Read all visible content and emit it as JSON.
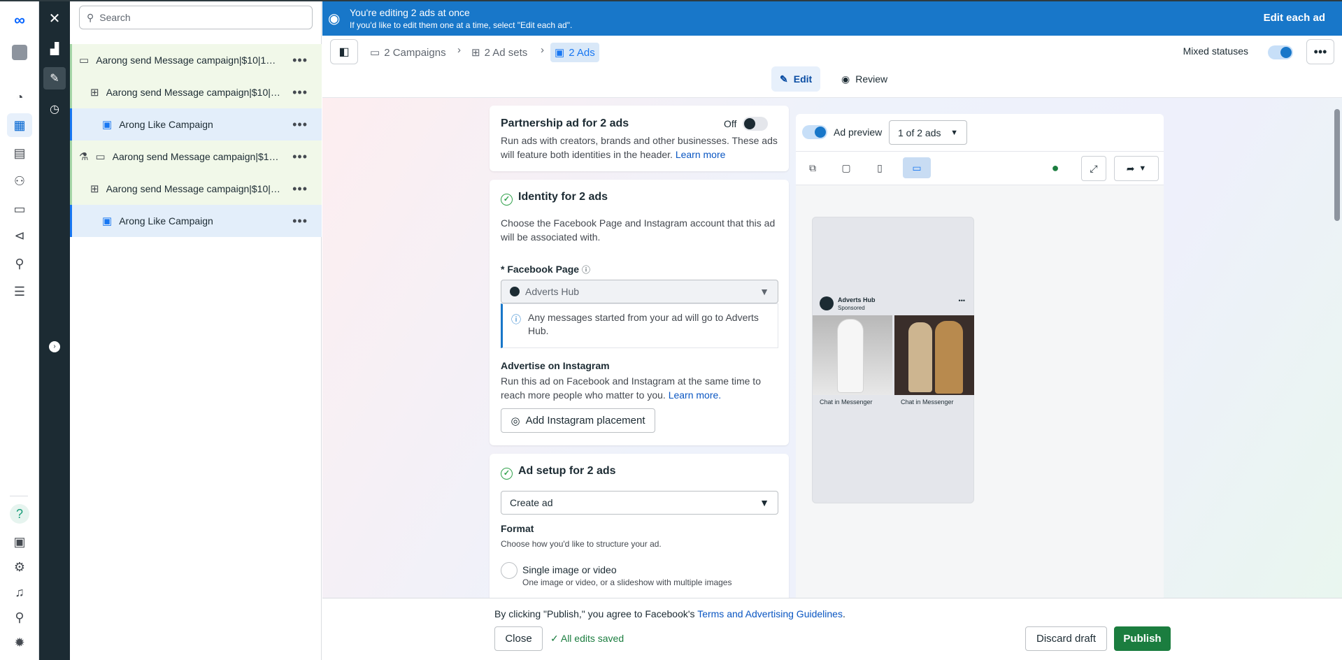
{
  "tree": {
    "search_placeholder": "Search",
    "rows": [
      {
        "type": "campaign",
        "label": "Aarong send Message campaign|$10|10 ..."
      },
      {
        "type": "adset",
        "label": "Aarong send Message campaign|$10|1..."
      },
      {
        "type": "ad",
        "label": "Arong Like Campaign"
      },
      {
        "type": "campaign",
        "label": "Aarong send Message campaign|$10|..."
      },
      {
        "type": "adset",
        "label": "Aarong send Message campaign|$10|1..."
      },
      {
        "type": "ad",
        "label": "Arong Like Campaign"
      }
    ]
  },
  "banner": {
    "title": "You're editing 2 ads at once",
    "subtitle": "If you'd like to edit them one at a time, select \"Edit each ad\".",
    "edit_each": "Edit each ad"
  },
  "header": {
    "breadcrumbs": [
      "2 Campaigns",
      "2 Ad sets",
      "2 Ads"
    ],
    "mixed_statuses": "Mixed statuses",
    "tabs": [
      "Edit",
      "Review"
    ]
  },
  "partnership": {
    "title": "Partnership ad for 2 ads",
    "toggle_label": "Off",
    "desc": "Run ads with creators, brands and other businesses. These ads will feature both identities in the header.",
    "learn_more": "Learn more"
  },
  "identity": {
    "title": "Identity for 2 ads",
    "desc": "Choose the Facebook Page and Instagram account that this ad will be associated with.",
    "fb_page_label": "* Facebook Page",
    "fb_page_value": "Adverts Hub",
    "info": "Any messages started from your ad will go to Adverts Hub.",
    "instagram_title": "Advertise on Instagram",
    "instagram_desc": "Run this ad on Facebook and Instagram at the same time to reach more people who matter to you.",
    "instagram_learn": "Learn more.",
    "add_instagram": "Add Instagram placement"
  },
  "ad_setup": {
    "title": "Ad setup for 2 ads",
    "select_value": "Create ad",
    "format_title": "Format",
    "format_desc": "Choose how you'd like to structure your ad.",
    "option_title": "Single image or video",
    "option_desc": "One image or video, or a slideshow with multiple images"
  },
  "preview": {
    "toggle_label": "Ad preview",
    "counter": "1 of 2 ads",
    "page_name": "Adverts Hub",
    "sponsored": "Sponsored",
    "cta1": "Chat in Messenger",
    "cta2": "Chat in Messenger"
  },
  "footer": {
    "terms_prefix": "By clicking \"Publish,\" you agree to Facebook's",
    "terms_link": "Terms and Advertising Guidelines",
    "close": "Close",
    "saved": "All edits saved",
    "discard": "Discard draft",
    "publish": "Publish"
  },
  "colors": {
    "banner": "#1877c9",
    "publish": "#1b7d3f",
    "campaign_row": "#f1f8e9",
    "ad_row": "#e3eefa"
  }
}
